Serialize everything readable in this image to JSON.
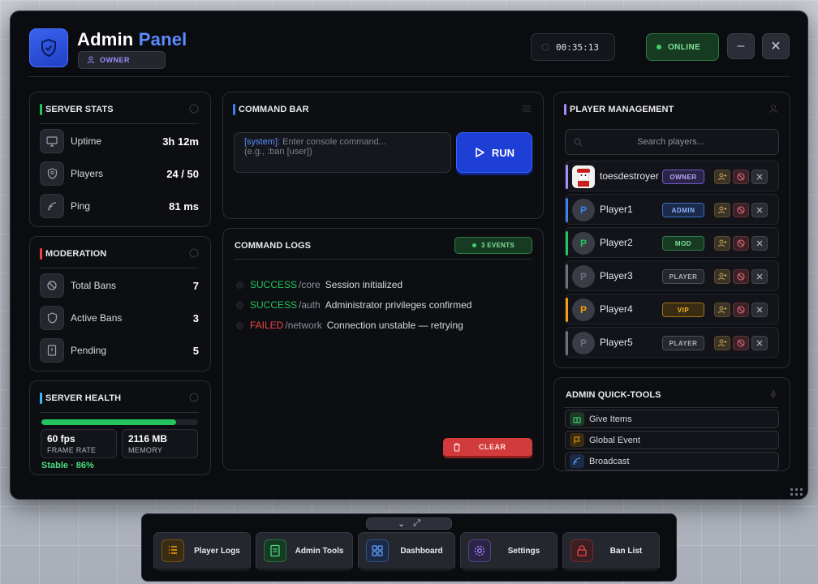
{
  "header": {
    "title_main": "Admin",
    "title_accent": "Panel",
    "role": "OWNER",
    "timer": "00:35:13",
    "status": "ONLINE"
  },
  "server_stats": {
    "title": "SERVER STATS",
    "rows": [
      {
        "label": "Uptime",
        "value": "3h 12m",
        "icon": "monitor-icon"
      },
      {
        "label": "Players",
        "value": "24 / 50",
        "icon": "shield-user-icon"
      },
      {
        "label": "Ping",
        "value": "81 ms",
        "icon": "signal-icon"
      }
    ]
  },
  "moderation": {
    "title": "MODERATION",
    "rows": [
      {
        "label": "Total Bans",
        "value": "7",
        "icon": "ban-icon"
      },
      {
        "label": "Active Bans",
        "value": "3",
        "icon": "shield-icon"
      },
      {
        "label": "Pending",
        "value": "5",
        "icon": "document-icon"
      }
    ]
  },
  "server_health": {
    "title": "SERVER HEALTH",
    "progress": 0.86,
    "fps_value": "60 fps",
    "fps_label": "FRAME RATE",
    "mem_value": "2116 MB",
    "mem_label": "MEMORY",
    "status": "Stable · 86%",
    "bar_color": "#22c55e"
  },
  "command_bar": {
    "title": "COMMAND BAR",
    "input_prefix": "[system]:",
    "input_placeholder": " Enter console command...",
    "input_hint": "(e.g., :ban [user])",
    "run_label": "RUN"
  },
  "command_logs": {
    "title": "COMMAND LOGS",
    "events_label": "3 EVENTS",
    "entries": [
      {
        "status": "SUCCESS",
        "path": "/core",
        "message": "Session initialized",
        "color": "#22c55e"
      },
      {
        "status": "SUCCESS",
        "path": "/auth",
        "message": "Administrator privileges confirmed",
        "color": "#22c55e"
      },
      {
        "status": "FAILED",
        "path": "/network",
        "message": "Connection unstable — retrying",
        "color": "#ef4444"
      }
    ],
    "clear_label": "CLEAR"
  },
  "player_management": {
    "title": "PLAYER MANAGEMENT",
    "search_placeholder": "Search players...",
    "players": [
      {
        "name": "toesdestroyer",
        "initial": "",
        "role": "OWNER",
        "stripe": "#a78bfa",
        "badge_bg": "#2b2446",
        "badge_border": "#6d5bd0",
        "badge_fg": "#b8a6ff"
      },
      {
        "name": "Player1",
        "initial": "P",
        "role": "ADMIN",
        "stripe": "#3b82f6",
        "badge_bg": "#1b2a48",
        "badge_border": "#3b6fd0",
        "badge_fg": "#8fb4ff"
      },
      {
        "name": "Player2",
        "initial": "P",
        "role": "MOD",
        "stripe": "#22c55e",
        "badge_bg": "#173a22",
        "badge_border": "#2f7a45",
        "badge_fg": "#7ee29a"
      },
      {
        "name": "Player3",
        "initial": "P",
        "role": "PLAYER",
        "stripe": "#6b7280",
        "badge_bg": "#24272e",
        "badge_border": "#4a4e58",
        "badge_fg": "#aeb3bd"
      },
      {
        "name": "Player4",
        "initial": "P",
        "role": "VIP",
        "stripe": "#f59e0b",
        "badge_bg": "#3a2c12",
        "badge_border": "#a3741c",
        "badge_fg": "#fbbf24"
      },
      {
        "name": "Player5",
        "initial": "P",
        "role": "PLAYER",
        "stripe": "#6b7280",
        "badge_bg": "#24272e",
        "badge_border": "#4a4e58",
        "badge_fg": "#aeb3bd"
      }
    ]
  },
  "quick_tools": {
    "title": "ADMIN QUICK-TOOLS",
    "items": [
      {
        "label": "Give Items",
        "icon": "gift-icon",
        "bg": "#1d3a26",
        "fg": "#4ade80"
      },
      {
        "label": "Global Event",
        "icon": "flag-icon",
        "bg": "#3a2c12",
        "fg": "#f59e0b"
      },
      {
        "label": "Broadcast",
        "icon": "broadcast-icon",
        "bg": "#1b2a48",
        "fg": "#60a5fa"
      }
    ]
  },
  "dock": {
    "items": [
      {
        "label": "Player Logs",
        "icon": "list-icon",
        "bg": "#3a2c12",
        "fg": "#f59e0b"
      },
      {
        "label": "Admin Tools",
        "icon": "file-icon",
        "bg": "#173a22",
        "fg": "#4ade80"
      },
      {
        "label": "Dashboard",
        "icon": "grid-icon",
        "bg": "#1b2a48",
        "fg": "#60a5fa"
      },
      {
        "label": "Settings",
        "icon": "gear-icon",
        "bg": "#2b2446",
        "fg": "#a78bfa"
      },
      {
        "label": "Ban List",
        "icon": "lock-icon",
        "bg": "#3b1e22",
        "fg": "#ef4444"
      }
    ]
  },
  "colors": {
    "accent": "#5b8cff",
    "success": "#22c55e",
    "danger": "#ef4444"
  }
}
